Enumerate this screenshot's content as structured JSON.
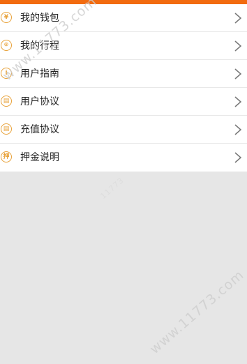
{
  "theme": {
    "accent": "#f26b0f",
    "icon_color": "#e8a23a",
    "background": "#e6e6e6"
  },
  "menu": {
    "items": [
      {
        "label": "我的钱包",
        "icon": "yen-icon",
        "glyph": "¥"
      },
      {
        "label": "我的行程",
        "icon": "location-icon",
        "glyph": "⌾"
      },
      {
        "label": "用户指南",
        "icon": "info-icon",
        "glyph": "i"
      },
      {
        "label": "用户协议",
        "icon": "document-icon",
        "glyph": "▤"
      },
      {
        "label": "充值协议",
        "icon": "recharge-document-icon",
        "glyph": "▤"
      },
      {
        "label": "押金说明",
        "icon": "deposit-icon",
        "glyph": "押"
      }
    ]
  },
  "watermark": {
    "text": "www.11773.com",
    "text_short": "11773"
  }
}
